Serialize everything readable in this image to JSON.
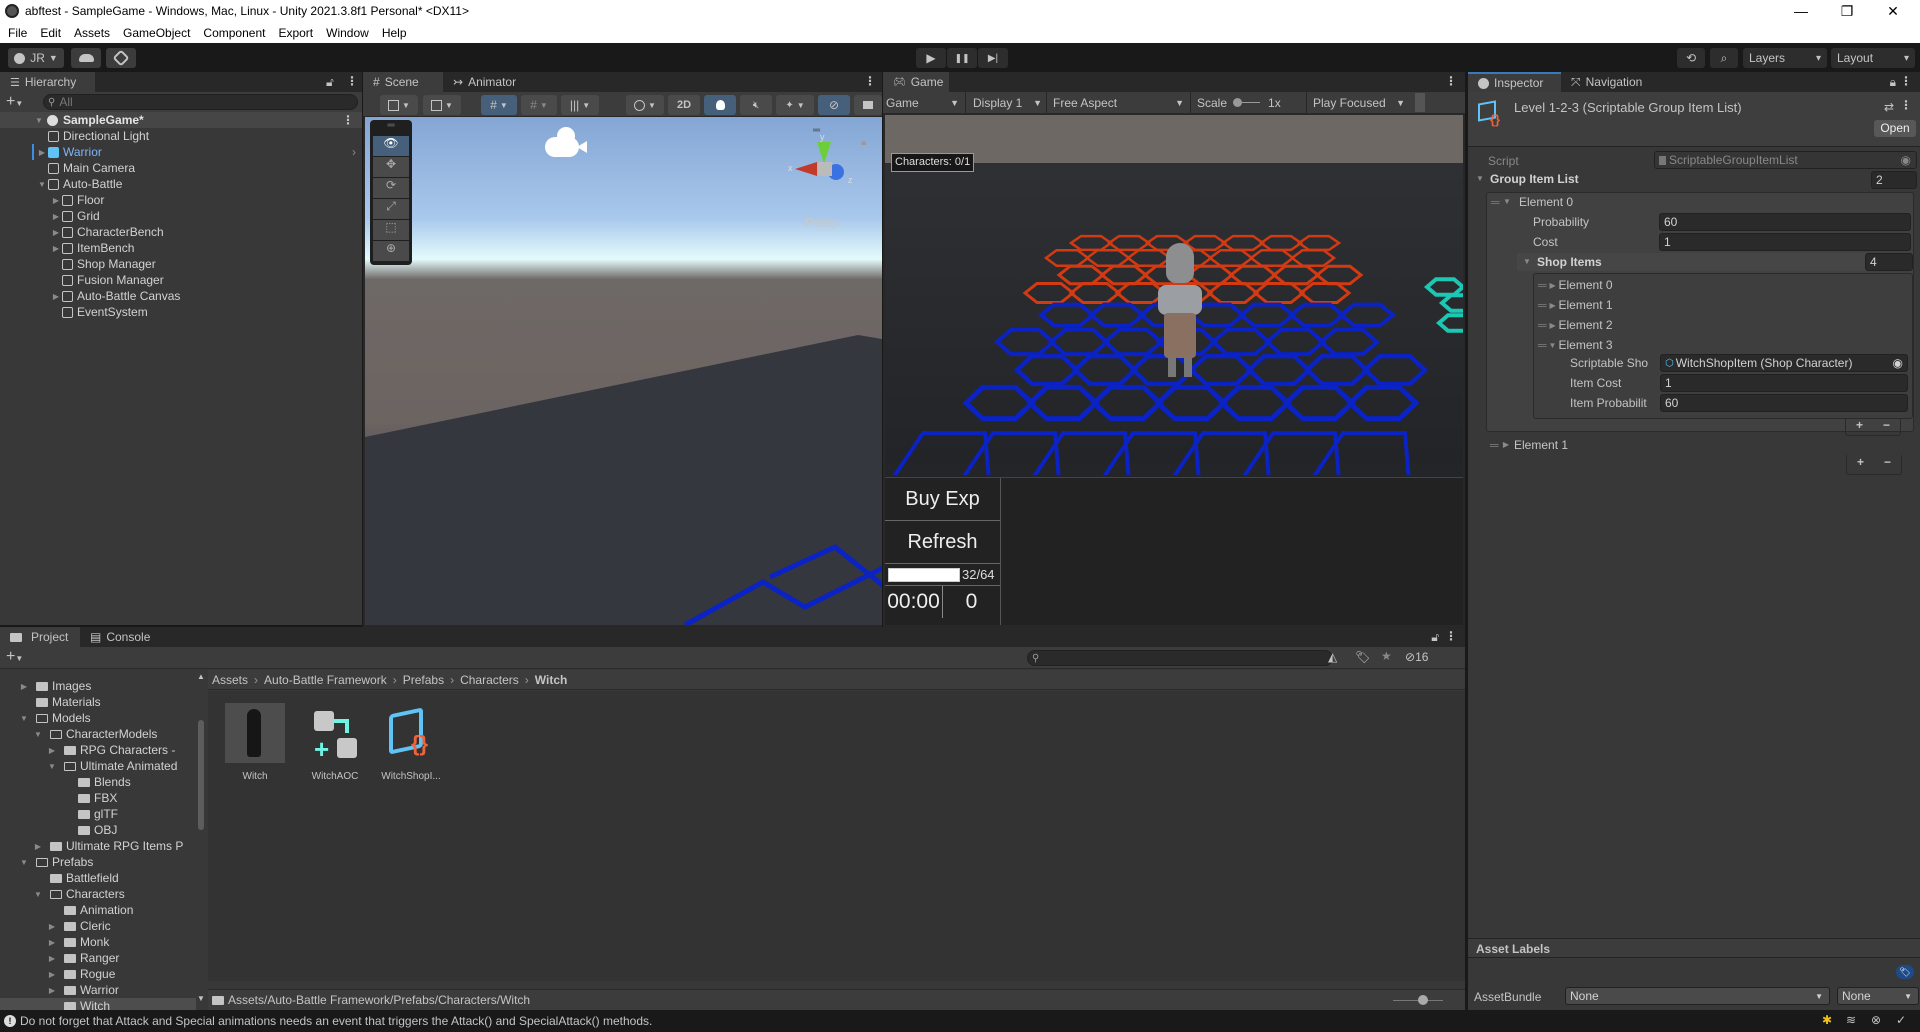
{
  "window": {
    "title": "abftest - SampleGame - Windows, Mac, Linux - Unity 2021.3.8f1 Personal* <DX11>",
    "controls": {
      "minimize": "—",
      "maximize": "❐",
      "close": "✕"
    }
  },
  "menu": [
    "File",
    "Edit",
    "Assets",
    "GameObject",
    "Component",
    "Export",
    "Window",
    "Help"
  ],
  "toolbar": {
    "account_label": "JR",
    "play_icon": "▶",
    "pause_icon": "❚❚",
    "step_icon": "▶|",
    "layers_label": "Layers",
    "layout_label": "Layout"
  },
  "hierarchy": {
    "tab_label": "Hierarchy",
    "search_placeholder": "All",
    "scene_name": "SampleGame*",
    "items": [
      {
        "label": "Directional Light",
        "depth": 1,
        "arrow": ""
      },
      {
        "label": "Warrior",
        "depth": 1,
        "arrow": "▶",
        "prefab": true
      },
      {
        "label": "Main Camera",
        "depth": 1,
        "arrow": ""
      },
      {
        "label": "Auto-Battle",
        "depth": 1,
        "arrow": "▼"
      },
      {
        "label": "Floor",
        "depth": 2,
        "arrow": "▶"
      },
      {
        "label": "Grid",
        "depth": 2,
        "arrow": "▶"
      },
      {
        "label": "CharacterBench",
        "depth": 2,
        "arrow": "▶"
      },
      {
        "label": "ItemBench",
        "depth": 2,
        "arrow": "▶"
      },
      {
        "label": "Shop Manager",
        "depth": 2,
        "arrow": ""
      },
      {
        "label": "Fusion Manager",
        "depth": 2,
        "arrow": ""
      },
      {
        "label": "Auto-Battle Canvas",
        "depth": 2,
        "arrow": "▶"
      },
      {
        "label": "EventSystem",
        "depth": 2,
        "arrow": ""
      }
    ]
  },
  "scene": {
    "tabs": [
      "Scene",
      "Animator"
    ],
    "toolbar": {
      "mode_2d": "2D"
    },
    "gizmo_label": "Persp",
    "axis_labels": {
      "x": "x",
      "y": "y",
      "z": "z"
    }
  },
  "game": {
    "tab_label": "Game",
    "view_dropdown": "Game",
    "display_dropdown": "Display 1",
    "aspect_dropdown": "Free Aspect",
    "scale_label": "Scale",
    "scale_value": "1x",
    "play_mode_dropdown": "Play Focused",
    "characters_label": "Characters: 0/1",
    "buy_exp_label": "Buy Exp",
    "refresh_label": "Refresh",
    "exp_text": "32/64",
    "exp_fraction": 0.5,
    "timer": "00:00",
    "gold": "0",
    "colors": {
      "enemy_hex": "#d43a12",
      "player_hex": "#0b22c4",
      "bench": "#0b22c4",
      "item_hex": "#1cc7b4"
    }
  },
  "inspector": {
    "tabs": [
      "Inspector",
      "Navigation"
    ],
    "asset_title": "Level 1-2-3 (Scriptable Group Item List)",
    "open_label": "Open",
    "script_label": "Script",
    "script_value": "ScriptableGroupItemList",
    "group_list_label": "Group Item List",
    "group_list_size": "2",
    "element0_label": "Element 0",
    "probability_label": "Probability",
    "probability_value": "60",
    "cost_label": "Cost",
    "cost_value": "1",
    "shop_items_label": "Shop Items",
    "shop_items_size": "4",
    "shop_elements": [
      "Element 0",
      "Element 1",
      "Element 2",
      "Element 3"
    ],
    "scriptable_shop_label": "Scriptable Sho",
    "scriptable_shop_value": "WitchShopItem (Shop Character)",
    "item_cost_label": "Item Cost",
    "item_cost_value": "1",
    "item_probability_label": "Item Probabilit",
    "item_probability_value": "60",
    "element1_label": "Element 1",
    "asset_labels_title": "Asset Labels",
    "assetbundle_label": "AssetBundle",
    "assetbundle_value": "None",
    "assetbundle_variant": "None"
  },
  "project": {
    "tabs": [
      "Project",
      "Console"
    ],
    "hidden_count": "16",
    "tree": [
      {
        "label": "Images",
        "depth": 1,
        "arrow": "▶",
        "open": false
      },
      {
        "label": "Materials",
        "depth": 1,
        "arrow": "",
        "open": false
      },
      {
        "label": "Models",
        "depth": 1,
        "arrow": "▼",
        "open": true
      },
      {
        "label": "CharacterModels",
        "depth": 2,
        "arrow": "▼",
        "open": true
      },
      {
        "label": "RPG Characters -",
        "depth": 3,
        "arrow": "▶",
        "open": false
      },
      {
        "label": "Ultimate Animated",
        "depth": 3,
        "arrow": "▼",
        "open": true
      },
      {
        "label": "Blends",
        "depth": 4,
        "arrow": "",
        "open": false
      },
      {
        "label": "FBX",
        "depth": 4,
        "arrow": "",
        "open": false
      },
      {
        "label": "glTF",
        "depth": 4,
        "arrow": "",
        "open": false
      },
      {
        "label": "OBJ",
        "depth": 4,
        "arrow": "",
        "open": false
      },
      {
        "label": "Ultimate RPG Items P",
        "depth": 2,
        "arrow": "▶",
        "open": false
      },
      {
        "label": "Prefabs",
        "depth": 1,
        "arrow": "▼",
        "open": true
      },
      {
        "label": "Battlefield",
        "depth": 2,
        "arrow": "",
        "open": false
      },
      {
        "label": "Characters",
        "depth": 2,
        "arrow": "▼",
        "open": true
      },
      {
        "label": "Animation",
        "depth": 3,
        "arrow": "",
        "open": false
      },
      {
        "label": "Cleric",
        "depth": 3,
        "arrow": "▶",
        "open": false
      },
      {
        "label": "Monk",
        "depth": 3,
        "arrow": "▶",
        "open": false
      },
      {
        "label": "Ranger",
        "depth": 3,
        "arrow": "▶",
        "open": false
      },
      {
        "label": "Rogue",
        "depth": 3,
        "arrow": "▶",
        "open": false
      },
      {
        "label": "Warrior",
        "depth": 3,
        "arrow": "▶",
        "open": false
      },
      {
        "label": "Witch",
        "depth": 3,
        "arrow": "",
        "open": false,
        "selected": true
      }
    ],
    "breadcrumb": [
      "Assets",
      "Auto-Battle Framework",
      "Prefabs",
      "Characters",
      "Witch"
    ],
    "assets": [
      {
        "label": "Witch",
        "type": "prefab"
      },
      {
        "label": "WitchAOC",
        "type": "animator-override"
      },
      {
        "label": "WitchShopI...",
        "type": "scriptable-object"
      }
    ],
    "path": "Assets/Auto-Battle Framework/Prefabs/Characters/Witch"
  },
  "status": {
    "message": "Do not forget that Attack and Special animations needs an event that triggers the Attack() and SpecialAttack() methods."
  }
}
